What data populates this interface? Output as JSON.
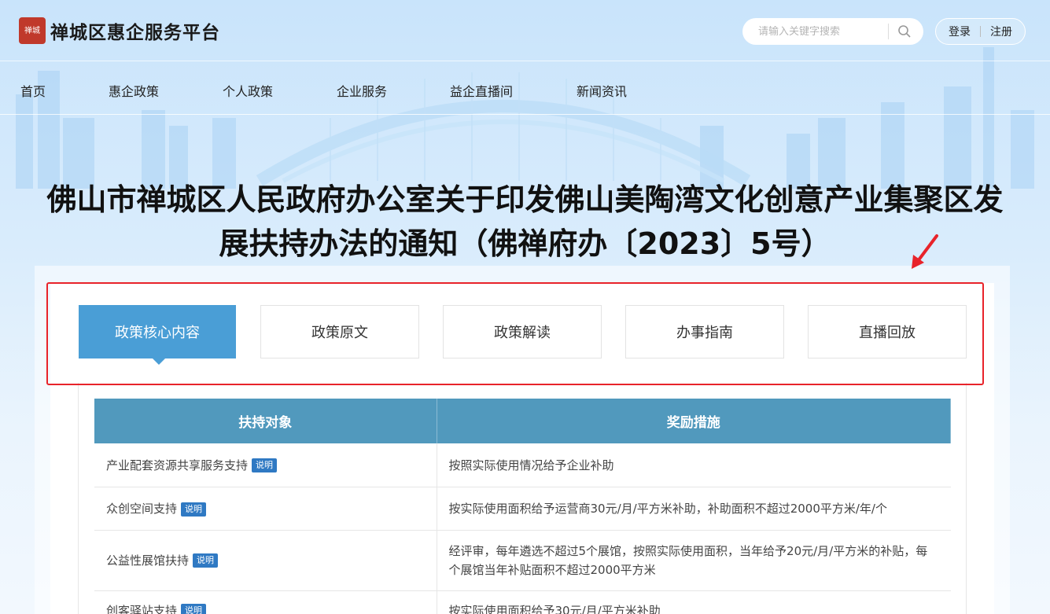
{
  "header": {
    "logo_seal": "禅城",
    "site_name": "禅城区惠企服务平台",
    "search_placeholder": "请输入关键字搜索",
    "login_label": "登录",
    "register_label": "注册"
  },
  "nav": {
    "items": [
      "首页",
      "惠企政策",
      "个人政策",
      "企业服务",
      "益企直播间",
      "新闻资讯"
    ]
  },
  "article": {
    "title_line1": "佛山市禅城区人民政府办公室关于印发佛山美陶湾文化创意产业集聚区发",
    "title_line2": "展扶持办法的通知（佛禅府办〔2023〕5号）"
  },
  "tabs": [
    {
      "label": "政策核心内容",
      "active": true
    },
    {
      "label": "政策原文",
      "active": false
    },
    {
      "label": "政策解读",
      "active": false
    },
    {
      "label": "办事指南",
      "active": false
    },
    {
      "label": "直播回放",
      "active": false
    }
  ],
  "table": {
    "headers": [
      "扶持对象",
      "奖励措施"
    ],
    "badge_label": "说明",
    "rows": [
      {
        "target": "产业配套资源共享服务支持",
        "measure": "按照实际使用情况给予企业补助"
      },
      {
        "target": "众创空间支持",
        "measure": "按实际使用面积给予运营商30元/月/平方米补助，补助面积不超过2000平方米/年/个"
      },
      {
        "target": "公益性展馆扶持",
        "measure": "经评审，每年遴选不超过5个展馆，按照实际使用面积，当年给予20元/月/平方米的补贴，每个展馆当年补贴面积不超过2000平方米"
      },
      {
        "target": "创客驿站支持",
        "measure": "按实际使用面积给予30元/月/平方米补助"
      }
    ]
  },
  "colors": {
    "accent": "#4a9ed6",
    "table_header": "#5199bd",
    "badge": "#2f79c3",
    "highlight": "#e8232a"
  }
}
